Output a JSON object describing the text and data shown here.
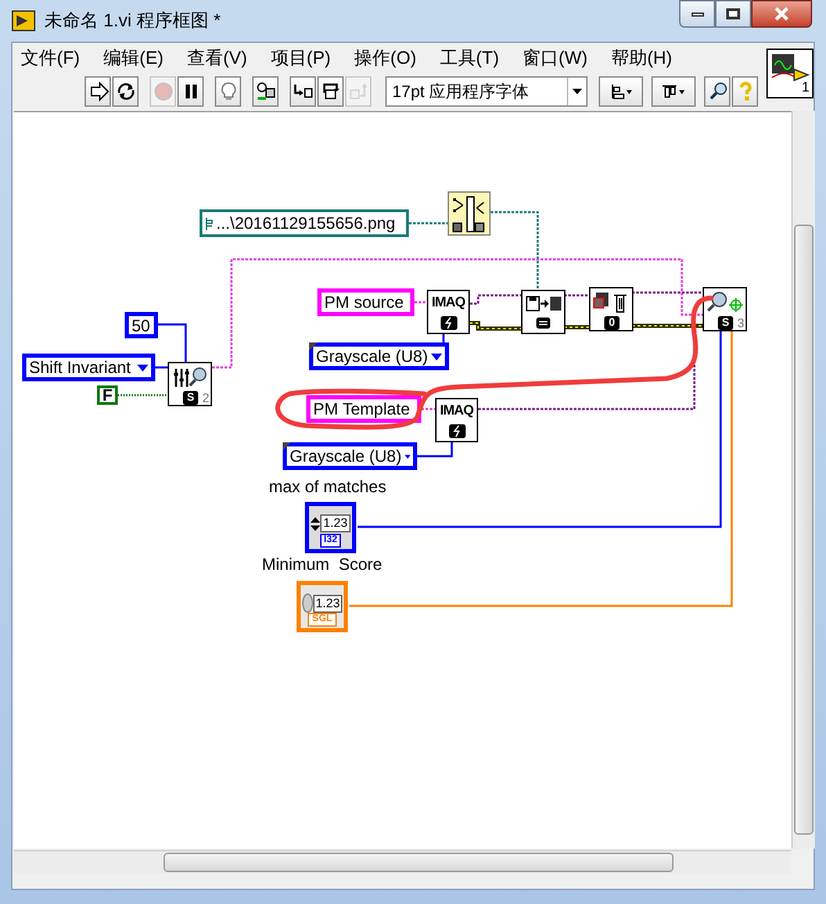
{
  "window": {
    "title": "未命名 1.vi 程序框图 *"
  },
  "menu": [
    "文件(F)",
    "编辑(E)",
    "查看(V)",
    "项目(P)",
    "操作(O)",
    "工具(T)",
    "窗口(W)",
    "帮助(H)"
  ],
  "toolbar": [
    {
      "kind": "run",
      "disabled": false
    },
    {
      "kind": "run-continuous",
      "disabled": false
    },
    {
      "kind": "abort",
      "disabled": true
    },
    {
      "kind": "pause",
      "disabled": false
    },
    {
      "kind": "highlight",
      "disabled": false
    },
    {
      "kind": "retain",
      "disabled": false
    },
    {
      "kind": "step-into",
      "disabled": false
    },
    {
      "kind": "step-over",
      "disabled": false
    },
    {
      "kind": "step-out",
      "disabled": true
    },
    {
      "kind": "font",
      "text": "17pt 应用程序字体"
    },
    {
      "kind": "align",
      "disabled": false
    },
    {
      "kind": "distribute",
      "disabled": false
    },
    {
      "kind": "search",
      "disabled": false
    },
    {
      "kind": "help",
      "disabled": false
    }
  ],
  "connector_pane": {
    "text": "1"
  },
  "diagram": {
    "constants": [
      {
        "kind": "path",
        "text": "...\\20161129155656.png"
      },
      {
        "kind": "numeric",
        "text": "50"
      },
      {
        "kind": "ring",
        "text": "Shift Invariant"
      },
      {
        "kind": "boolean",
        "text": "F"
      },
      {
        "kind": "string",
        "text": "PM source"
      },
      {
        "kind": "enum",
        "text": "Grayscale (U8)"
      },
      {
        "kind": "string",
        "text": "PM Template"
      },
      {
        "kind": "enum",
        "text": "Grayscale (U8)"
      }
    ],
    "nodes": [
      {
        "kind": "build",
        "badge": "S",
        "subscript": "2"
      },
      {
        "kind": "merge"
      },
      {
        "kind": "imaq",
        "caption": "IMAQ"
      },
      {
        "kind": "read"
      },
      {
        "kind": "dispose",
        "badge": "0"
      },
      {
        "kind": "match",
        "badge": "S",
        "subscript": "3"
      },
      {
        "kind": "imaq",
        "caption": "IMAQ"
      }
    ],
    "controls": [
      {
        "type": "I32",
        "label": "max of matches",
        "display": "1.23"
      },
      {
        "type": "SGL",
        "label": "Minimum  Score",
        "display": "1.23"
      }
    ],
    "annotation": {
      "kind": "freehand"
    }
  }
}
